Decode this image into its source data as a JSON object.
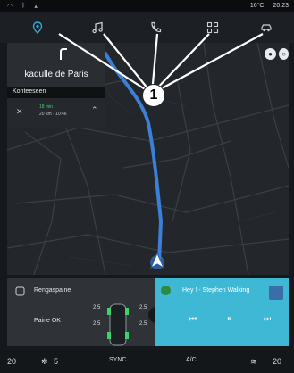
{
  "status_bar": {
    "temperature": "16°C",
    "time": "20:23"
  },
  "nav_bar": {
    "items": [
      {
        "icon": "navigation-pin-icon",
        "active": true
      },
      {
        "icon": "music-note-icon",
        "active": false
      },
      {
        "icon": "phone-icon",
        "active": false
      },
      {
        "icon": "apps-grid-icon",
        "active": false
      },
      {
        "icon": "car-icon",
        "active": false
      }
    ],
    "active_color": "#2fa7d6"
  },
  "navigation": {
    "street": "kadulle  de Paris",
    "destination_label": "Kohteeseen",
    "trip_time": "18 min",
    "trip_details": "20 km · 10:46"
  },
  "callout": {
    "number": "1"
  },
  "tire_widget": {
    "title": "Rengaspaine",
    "status": "Paine OK",
    "pressures": {
      "front_left": "2.5",
      "front_right": "2.5",
      "rear_left": "2.5",
      "rear_right": "2.5"
    }
  },
  "music_widget": {
    "track": "Hey ! - Stephen Walking",
    "background": "#3fb8d6"
  },
  "climate": {
    "left_temp": "20",
    "fan_speed": "5",
    "sync_label": "SYNC",
    "ac_label": "A/C",
    "right_temp": "20"
  },
  "colors": {
    "route": "#3c7fd6",
    "map_bg": "#23272c",
    "ok_green": "#3fd16a"
  }
}
